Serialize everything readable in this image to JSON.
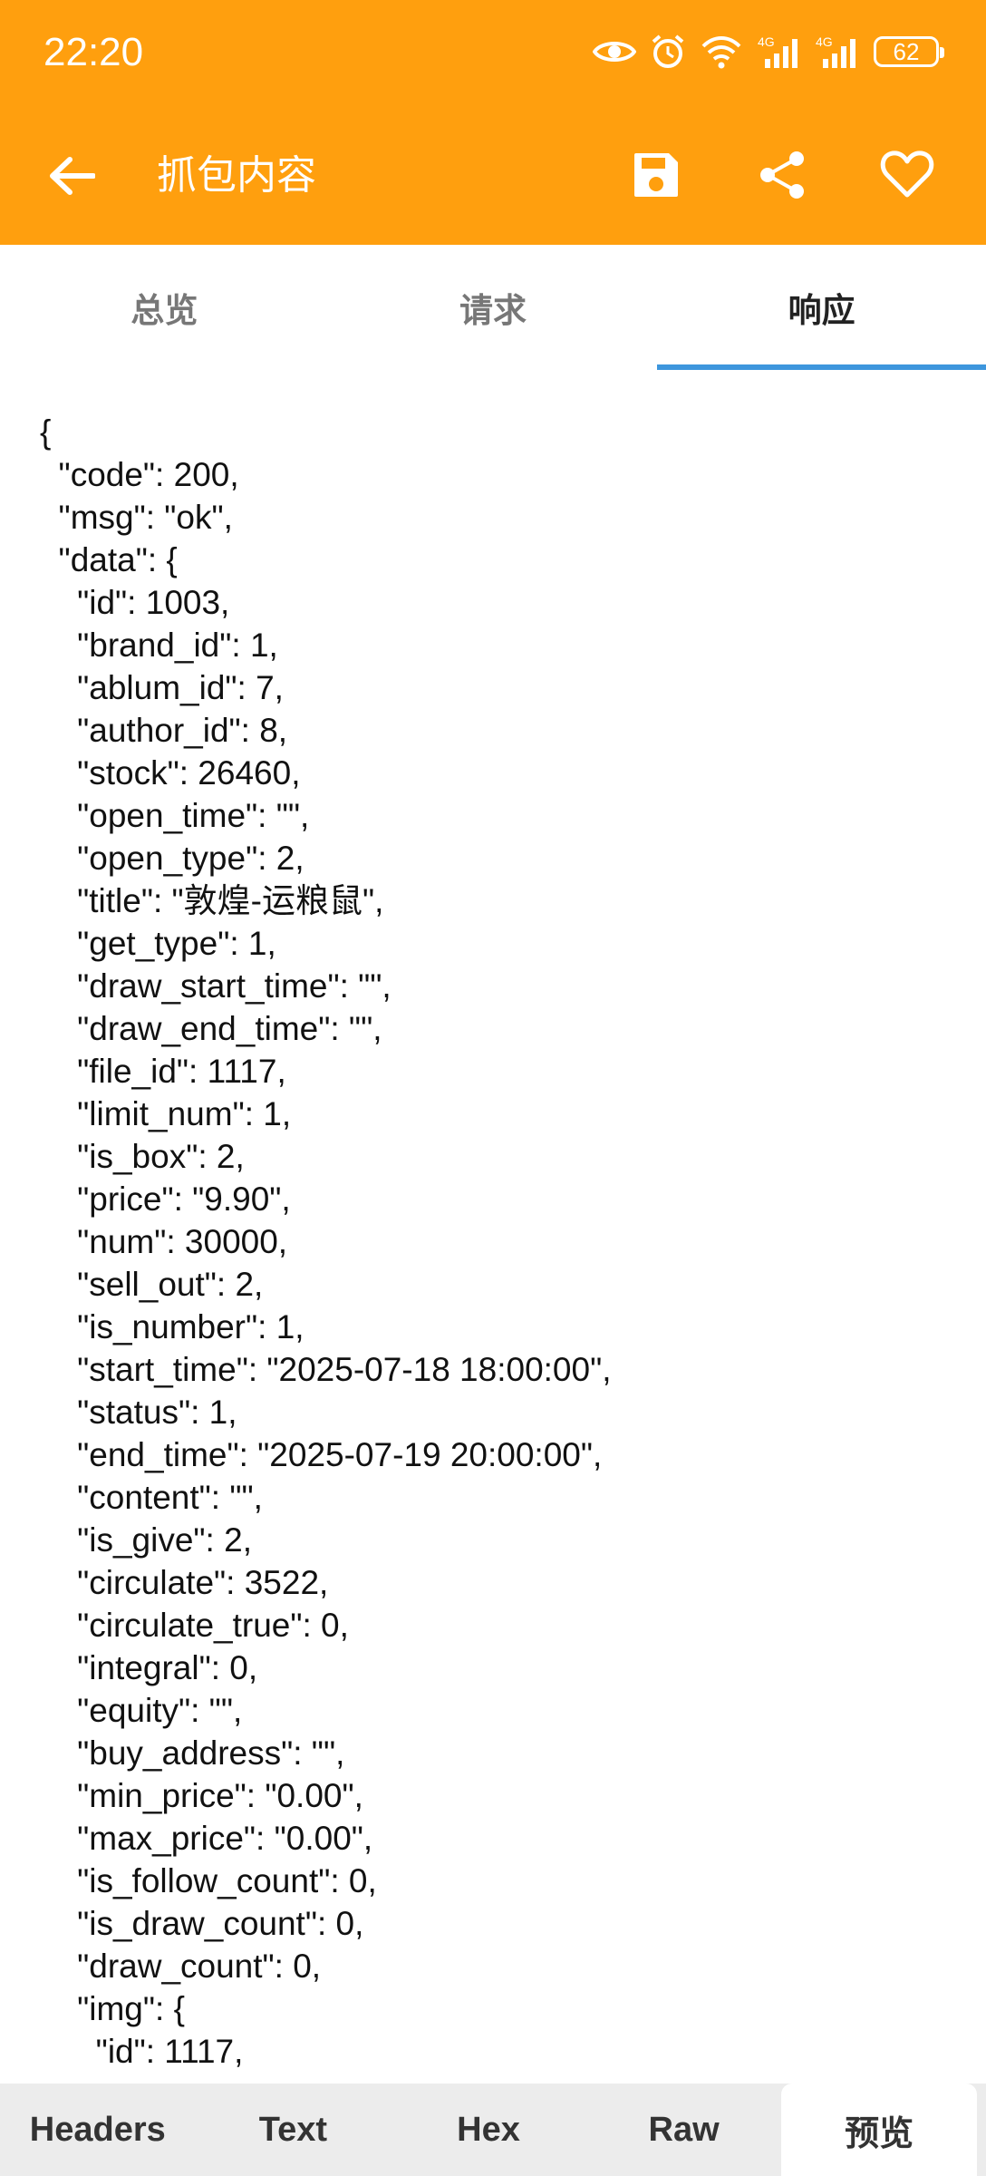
{
  "status_bar": {
    "time": "22:20",
    "battery": "62",
    "icons": [
      "eye-icon",
      "alarm-icon",
      "wifi-icon",
      "signal-4g-icon",
      "signal-4g-icon",
      "battery-icon"
    ]
  },
  "toolbar": {
    "title": "抓包内容",
    "icons": [
      "back-arrow-icon",
      "save-icon",
      "share-icon",
      "heart-icon"
    ],
    "background_color": "#FF9F0E"
  },
  "tabs": [
    {
      "label": "总览",
      "active": false
    },
    {
      "label": "请求",
      "active": false
    },
    {
      "label": "响应",
      "active": true
    }
  ],
  "tab_indicator_color": "#3D96DD",
  "response_body": "{\n  \"code\": 200,\n  \"msg\": \"ok\",\n  \"data\": {\n    \"id\": 1003,\n    \"brand_id\": 1,\n    \"ablum_id\": 7,\n    \"author_id\": 8,\n    \"stock\": 26460,\n    \"open_time\": \"\",\n    \"open_type\": 2,\n    \"title\": \"敦煌-运粮鼠\",\n    \"get_type\": 1,\n    \"draw_start_time\": \"\",\n    \"draw_end_time\": \"\",\n    \"file_id\": 1117,\n    \"limit_num\": 1,\n    \"is_box\": 2,\n    \"price\": \"9.90\",\n    \"num\": 30000,\n    \"sell_out\": 2,\n    \"is_number\": 1,\n    \"start_time\": \"2025-07-18 18:00:00\",\n    \"status\": 1,\n    \"end_time\": \"2025-07-19 20:00:00\",\n    \"content\": \"\",\n    \"is_give\": 2,\n    \"circulate\": 3522,\n    \"circulate_true\": 0,\n    \"integral\": 0,\n    \"equity\": \"\",\n    \"buy_address\": \"\",\n    \"min_price\": \"0.00\",\n    \"max_price\": \"0.00\",\n    \"is_follow_count\": 0,\n    \"is_draw_count\": 0,\n    \"draw_count\": 0,\n    \"img\": {\n      \"id\": 1117,",
  "bottom_tabs": [
    {
      "label": "Headers",
      "active": false
    },
    {
      "label": "Text",
      "active": false
    },
    {
      "label": "Hex",
      "active": false
    },
    {
      "label": "Raw",
      "active": false
    },
    {
      "label": "预览",
      "active": true
    }
  ]
}
